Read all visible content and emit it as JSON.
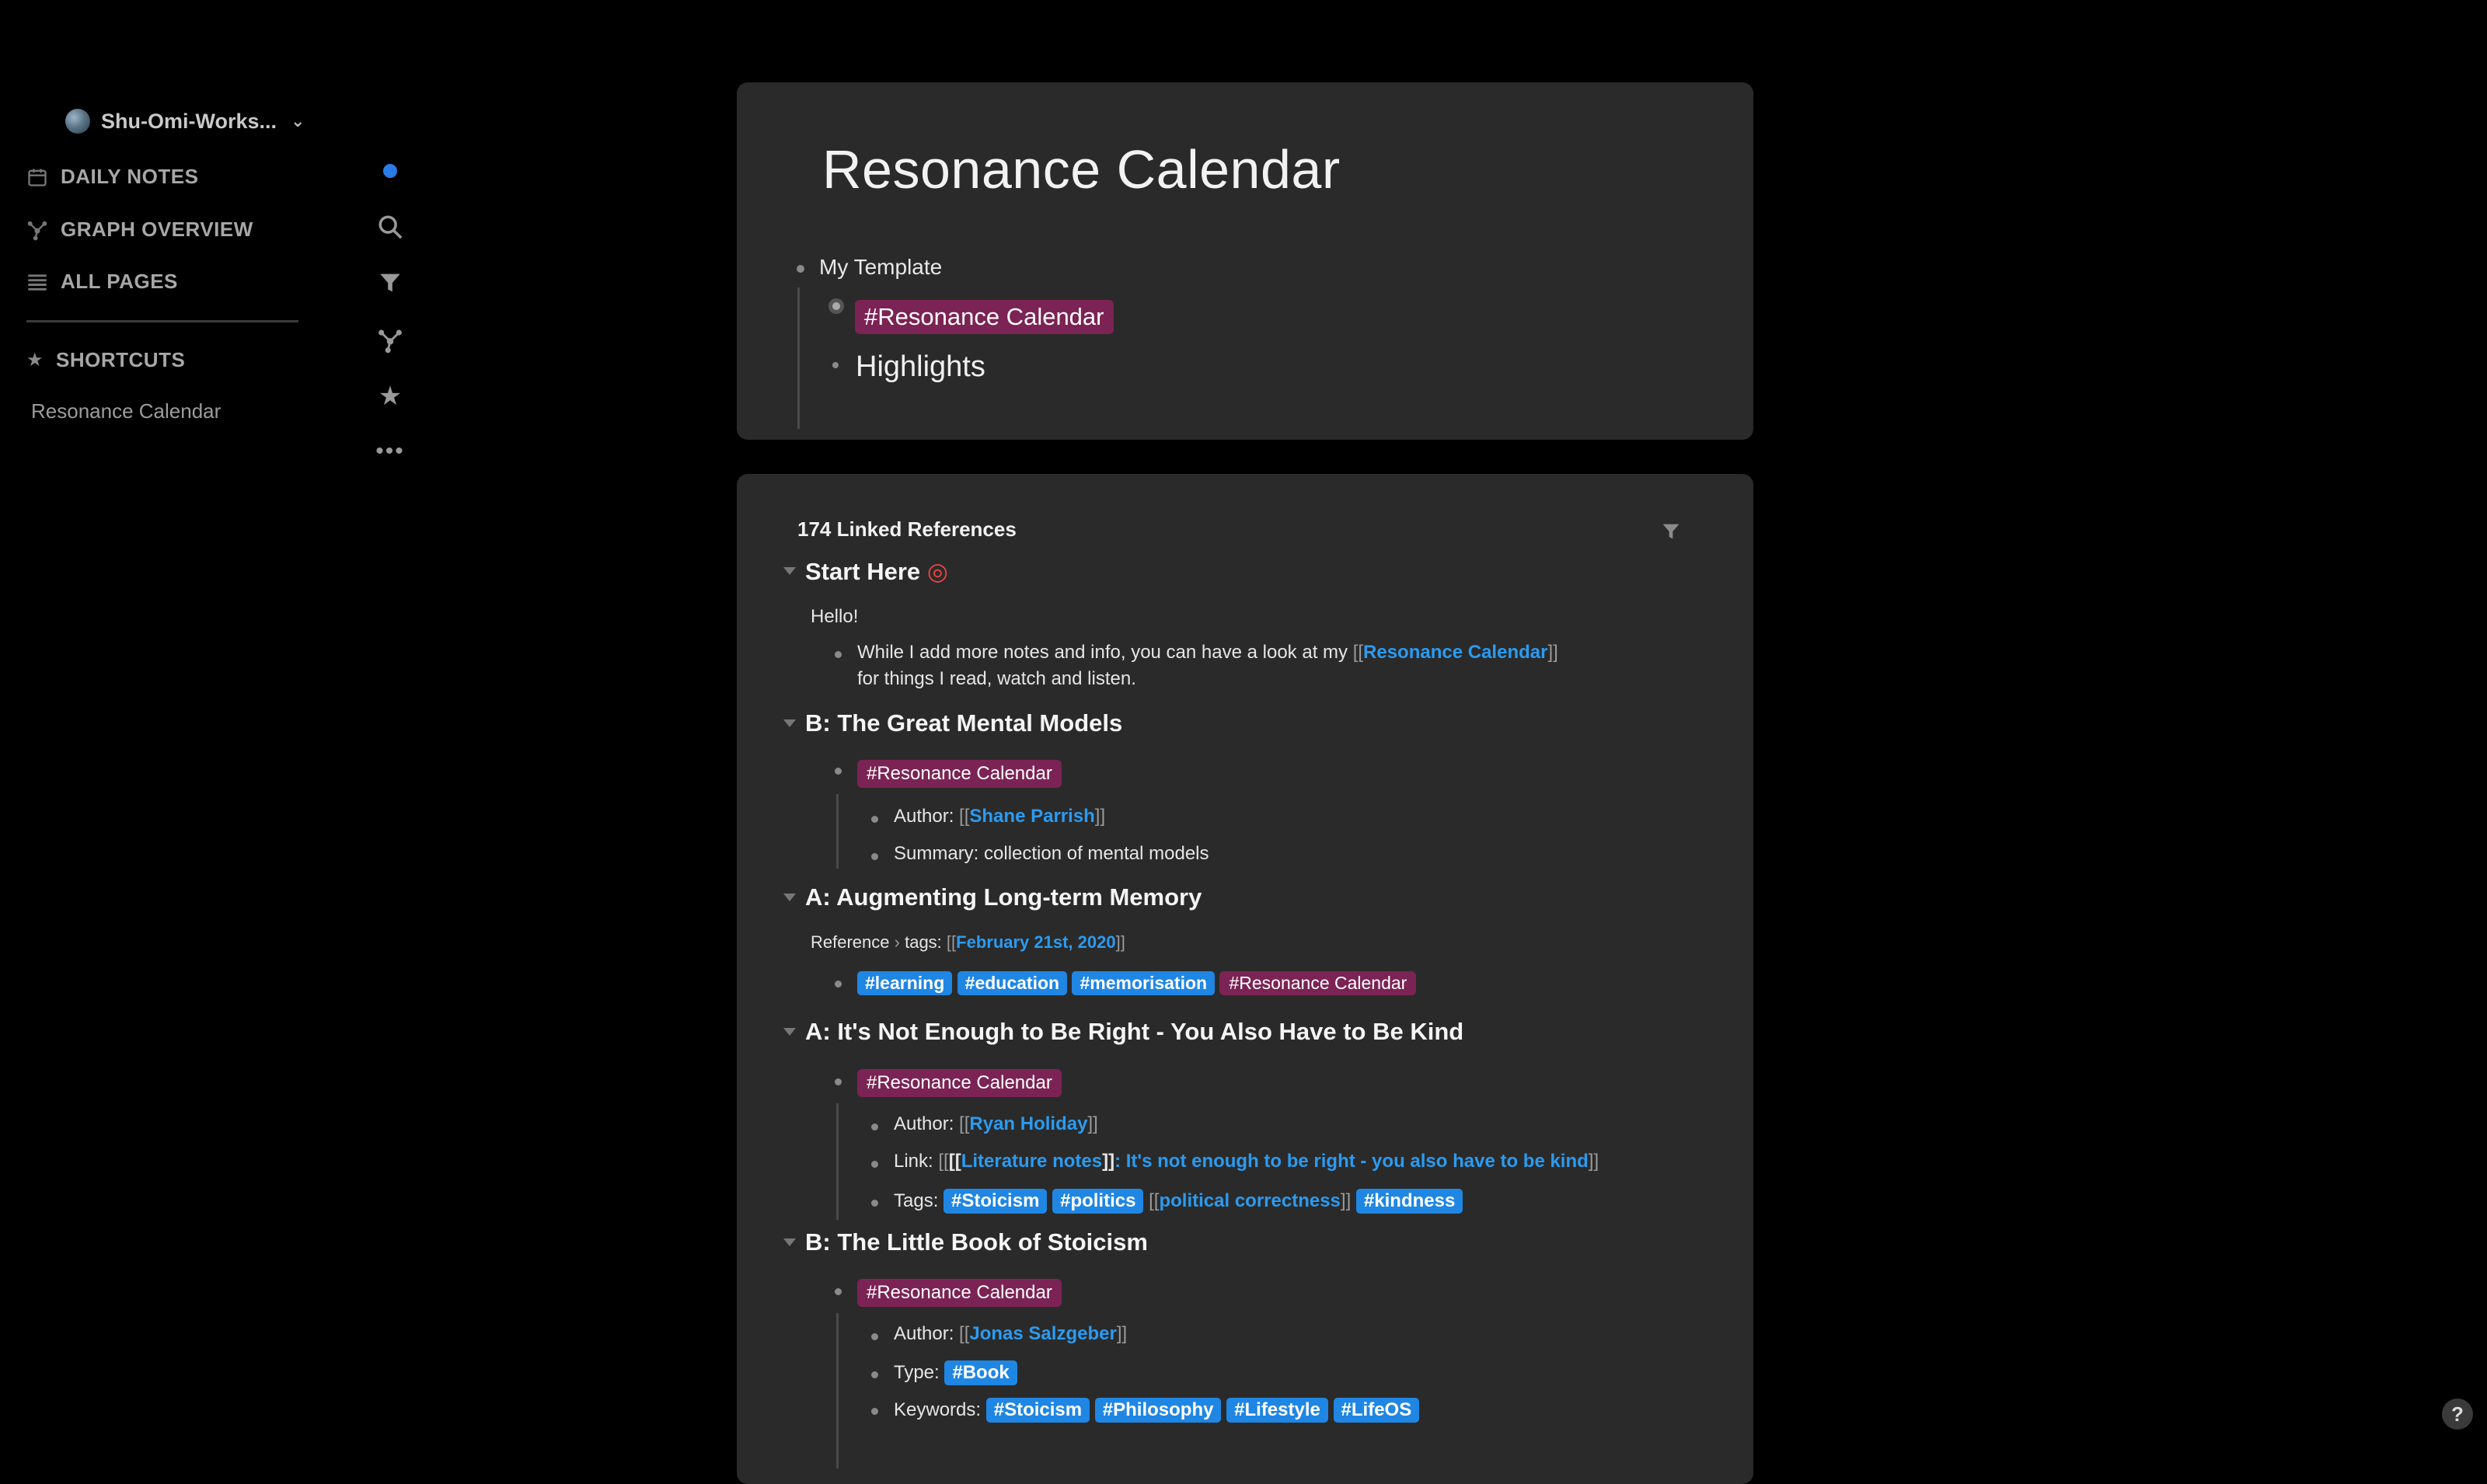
{
  "sidebar": {
    "workspace": "Shu-Omi-Works...",
    "nav": {
      "daily_notes": "DAILY NOTES",
      "graph_overview": "GRAPH OVERVIEW",
      "all_pages": "ALL PAGES"
    },
    "shortcuts_label": "SHORTCUTS",
    "shortcuts": [
      "Resonance Calendar"
    ]
  },
  "page": {
    "title": "Resonance Calendar",
    "template_label": "My Template",
    "template_tag": "#Resonance Calendar",
    "highlights": "Highlights"
  },
  "refs": {
    "count_label": "174 Linked References",
    "start_here": {
      "title": "Start Here",
      "hello": "Hello!",
      "line1_pre": "While I add more notes and info, you can have a look at my ",
      "line1_link": "Resonance Calendar",
      "line2": "for things I read, watch and listen."
    },
    "mental_models": {
      "title": "B: The Great Mental Models",
      "tag": "#Resonance Calendar",
      "author_label": "Author: ",
      "author": "Shane Parrish",
      "summary": "Summary: collection of mental models"
    },
    "memory": {
      "title": "A: Augmenting Long-term Memory",
      "breadcrumb_a": "Reference",
      "breadcrumb_b": "tags: ",
      "date_link": "February 21st, 2020",
      "tags": [
        "#learning",
        "#education",
        "#memorisation"
      ],
      "pink_tag": "#Resonance Calendar"
    },
    "kind": {
      "title": "A: It's Not Enough to Be Right - You Also Have to Be Kind",
      "tag": "#Resonance Calendar",
      "author_label": "Author: ",
      "author": "Ryan Holiday",
      "link_label": "Link: ",
      "link_a": "Literature notes",
      "link_b": "It's not enough to be right - you also have to be kind",
      "tags_label": "Tags: ",
      "tag1": "#Stoicism",
      "tag2": "#politics",
      "tag3_link": "political correctness",
      "tag4": "#kindness"
    },
    "stoicism": {
      "title": "B: The Little Book of Stoicism",
      "tag": "#Resonance Calendar",
      "author_label": "Author: ",
      "author": "Jonas Salzgeber",
      "type_label": "Type: ",
      "type_tag": "#Book",
      "keywords_label": "Keywords: ",
      "keywords": [
        "#Stoicism",
        "#Philosophy",
        "#Lifestyle",
        "#LifeOS"
      ]
    }
  },
  "help": "?"
}
